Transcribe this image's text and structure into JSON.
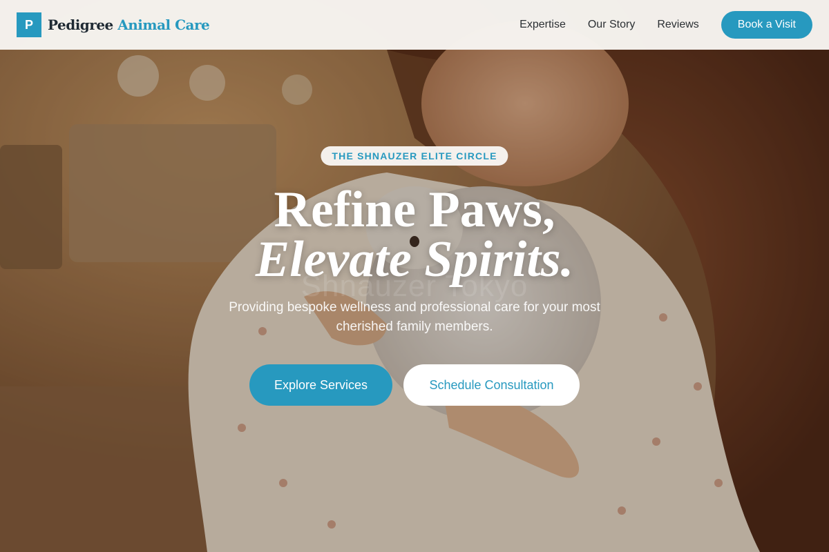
{
  "brand": {
    "logo_letter": "P",
    "name_part1": "Pedigree",
    "name_part2": "Animal Care",
    "accent_color": "#2799bf"
  },
  "nav": {
    "links": [
      "Expertise",
      "Our Story",
      "Reviews"
    ],
    "cta_label": "Book a Visit"
  },
  "hero": {
    "badge": "THE SHNAUZER ELITE CIRCLE",
    "title_line1": "Refine Paws,",
    "title_line2": "Elevate Spirits.",
    "watermark": "Shnauzer Tokyo",
    "subtitle": "Providing bespoke wellness and professional care for your most cherished family members.",
    "primary_button": "Explore Services",
    "secondary_button": "Schedule Consultation"
  }
}
